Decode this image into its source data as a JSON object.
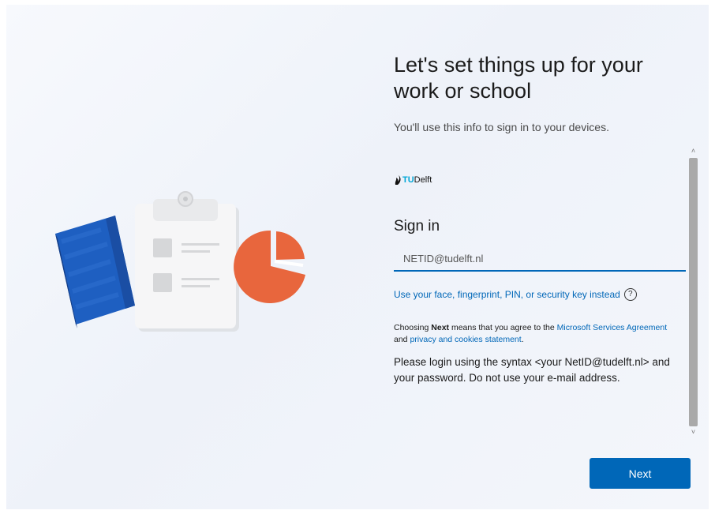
{
  "header": {
    "title": "Let's set things up for your work or school",
    "subtitle": "You'll use this info to sign in to your devices."
  },
  "org": {
    "logo_prefix": "TU",
    "logo_name": "Delft"
  },
  "signin": {
    "heading": "Sign in",
    "email_placeholder": "NETID@tudelft.nl",
    "alt_link": "Use your face, fingerprint, PIN, or security key instead",
    "help_glyph": "?",
    "terms_prefix": "Choosing ",
    "terms_bold": "Next",
    "terms_middle": " means that you agree to the ",
    "terms_link1": "Microsoft Services Agreement",
    "terms_and": " and ",
    "terms_link2": "privacy and cookies statement",
    "terms_end": ".",
    "instructions": "Please login using the syntax <your NetID@tudelft.nl> and your password. Do not use your e-mail address."
  },
  "scrollbar": {
    "up_glyph": "˄",
    "down_glyph": "˅"
  },
  "footer": {
    "next_label": "Next"
  },
  "colors": {
    "accent": "#0067b8",
    "notebook": "#1e5fc1",
    "chart": "#e8663d"
  },
  "icons": {
    "help": "help-circle-icon",
    "logo": "tudelft-flame-icon"
  }
}
